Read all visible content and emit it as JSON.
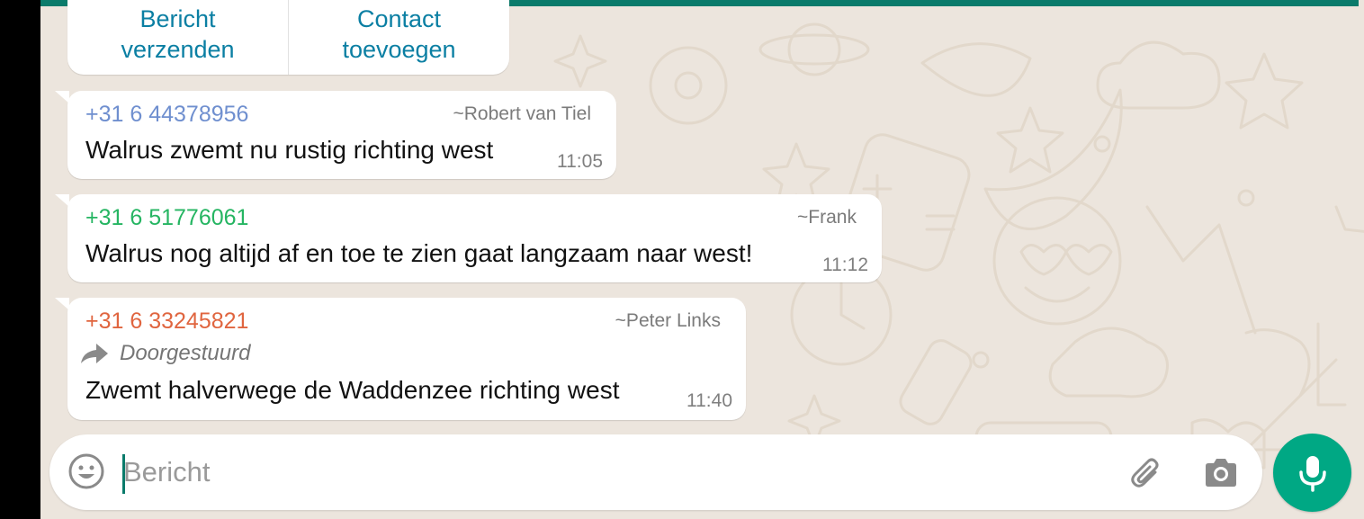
{
  "actions": {
    "send_message_label": "Bericht\nverzenden",
    "add_contact_label": "Contact\ntoevoegen"
  },
  "messages": [
    {
      "phone": "+31 6 44378956",
      "name": "~Robert van Tiel",
      "text": "Walrus zwemt nu rustig richting west",
      "time": "11:05",
      "sender_color": "#6f8fcf"
    },
    {
      "phone": "+31 6 51776061",
      "name": "~Frank",
      "text": "Walrus nog altijd af en toe te zien gaat langzaam naar west!",
      "time": "11:12",
      "sender_color": "#25b562"
    },
    {
      "phone": "+31 6 33245821",
      "name": "~Peter Links",
      "forwarded_label": "Doorgestuurd",
      "text": "Zwemt halverwege de Waddenzee richting west",
      "time": "11:40",
      "sender_color": "#e0653f"
    }
  ],
  "composer": {
    "placeholder": "Bericht",
    "emoji_icon": "emoji-icon",
    "attach_icon": "paperclip-icon",
    "camera_icon": "camera-icon",
    "mic_icon": "microphone-icon"
  },
  "colors": {
    "accent": "#00a884",
    "header": "#0a7b6b",
    "chat_background": "#ece5dd",
    "action_text": "#0b7fa3"
  }
}
